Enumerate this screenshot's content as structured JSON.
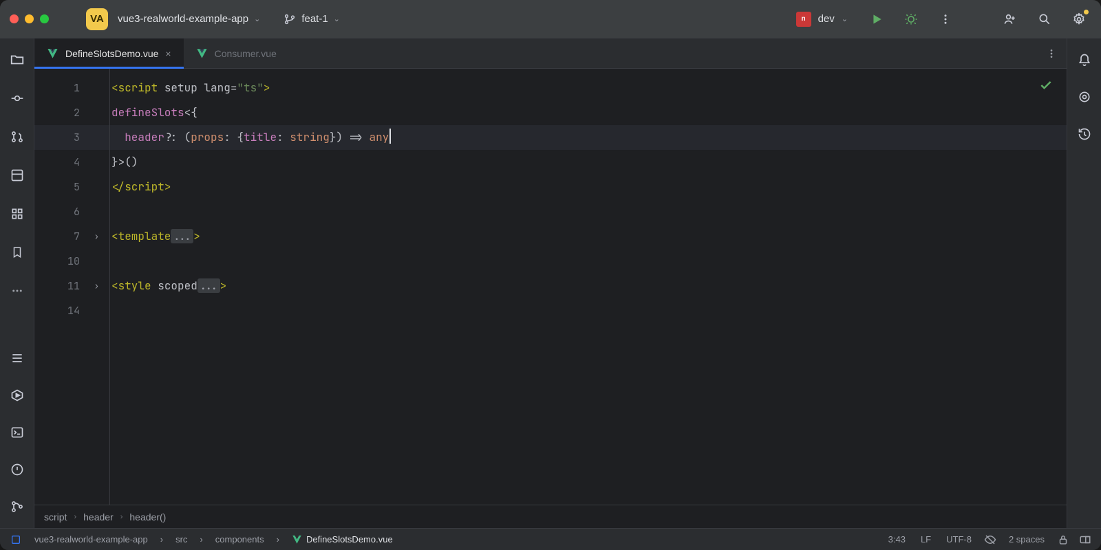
{
  "window": {
    "project_badge": "VA",
    "project_name": "vue3-realworld-example-app",
    "branch": "feat-1",
    "run_config": "dev"
  },
  "tabs": [
    {
      "label": "DefineSlotsDemo.vue",
      "active": true,
      "closable": true
    },
    {
      "label": "Consumer.vue",
      "active": false,
      "closable": false
    }
  ],
  "gutter_lines": [
    "1",
    "2",
    "3",
    "4",
    "5",
    "6",
    "7",
    "10",
    "11",
    "14"
  ],
  "folds": {
    "line7": true,
    "line11": true
  },
  "cursor": {
    "line": 3,
    "col": 43
  },
  "code": {
    "l1": {
      "open": "<",
      "tag": "script",
      "attrs": " setup lang=",
      "str": "\"ts\"",
      "close": ">"
    },
    "l2": {
      "fn": "defineSlots",
      "rest": "<{"
    },
    "l3": {
      "indent": "  ",
      "key": "header",
      "opt": "?: (",
      "param": "props",
      "colon": ": {",
      "field": "title",
      "colon2": ": ",
      "type": "string",
      "close": "}) => ",
      "ret": "any"
    },
    "l4": "}>()",
    "l5": {
      "open": "</",
      "tag": "script",
      "close": ">"
    },
    "l7": {
      "open": "<",
      "tag": "template",
      "fold": "...",
      "close": ">"
    },
    "l11": {
      "open": "<",
      "tag": "style",
      "attr": " scoped",
      "fold": "...",
      "close": ">"
    }
  },
  "breadcrumbs": [
    "script",
    "header",
    "header()"
  ],
  "statusbar": {
    "project": "vue3-realworld-example-app",
    "path": [
      "src",
      "components",
      "DefineSlotsDemo.vue"
    ],
    "cursor_pos": "3:43",
    "line_end": "LF",
    "encoding": "UTF-8",
    "indent": "2 spaces"
  },
  "icons": {
    "chevron": "⌄",
    "branch": "branch-icon",
    "play": "play-icon",
    "debug": "bug-icon",
    "more": "more-vert-icon",
    "collab": "collab-icon",
    "search": "search-icon",
    "settings": "gear-icon",
    "folder": "folder-icon",
    "commit": "commit-icon",
    "pull": "pull-requests-icon",
    "structure": "structure-icon",
    "services": "services-icon",
    "bookmark": "bookmark-icon",
    "more-h": "more-horiz-icon",
    "todo": "todo-icon",
    "run-hex": "run-tool-icon",
    "terminal": "terminal-icon",
    "problems": "problems-icon",
    "git": "git-icon",
    "notifications": "bell-icon",
    "ai": "ai-icon",
    "history": "history-icon",
    "inspection": "check-icon",
    "readonly": "readonly-icon",
    "eye": "no-preview-icon"
  }
}
